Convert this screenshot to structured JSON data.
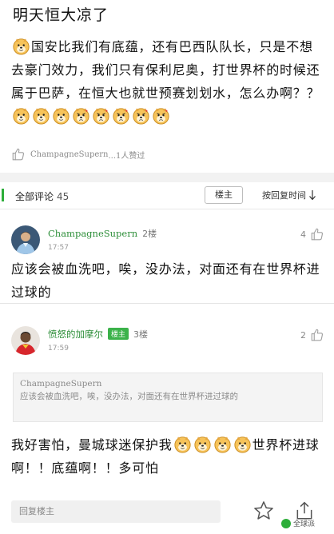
{
  "post": {
    "title": "明天恒大凉了",
    "body_part1": "国安比我们有底蕴，还有巴西队队长，只是不想去豪门效力，我们只有保利尼奥，打世界杯的时候还属于巴萨，在恒大也就世预赛划划水，怎么办啊？？",
    "likes_user": "ChampagneSupern",
    "likes_suffix": "...1人赞过"
  },
  "comments_header": {
    "label": "全部评论",
    "count": "45",
    "owner_only": "楼主",
    "sort": "按回复时间"
  },
  "comments": [
    {
      "name": "ChampagneSupern",
      "floor": "2楼",
      "time": "17:57",
      "likes": "4",
      "text": "应该会被血洗吧，唉，没办法，对面还有在世界杯进过球的"
    },
    {
      "name": "愤怒的加摩尔",
      "badge": "楼主",
      "floor": "3楼",
      "time": "17:59",
      "likes": "2",
      "quote_user": "ChampagneSupern",
      "quote_text": "应该会被血洗吧，唉，没办法，对面还有在世界杯进过球的",
      "text_before": "我好害怕，曼城球迷保护我",
      "text_after": "世界杯进球啊！！底蕴啊！！多可怕"
    }
  ],
  "bottom": {
    "reply_placeholder": "回复楼主",
    "watermark": "全球派"
  },
  "icons": {
    "emoji": "doge-emoji",
    "emoji_angry": "angry-doge-emoji",
    "like": "thumbs-up-icon",
    "star": "star-icon",
    "share": "share-icon",
    "sort_arrow": "arrow-down-icon"
  },
  "colors": {
    "accent_green": "#2dae3a",
    "username_green": "#2e8f3a"
  }
}
